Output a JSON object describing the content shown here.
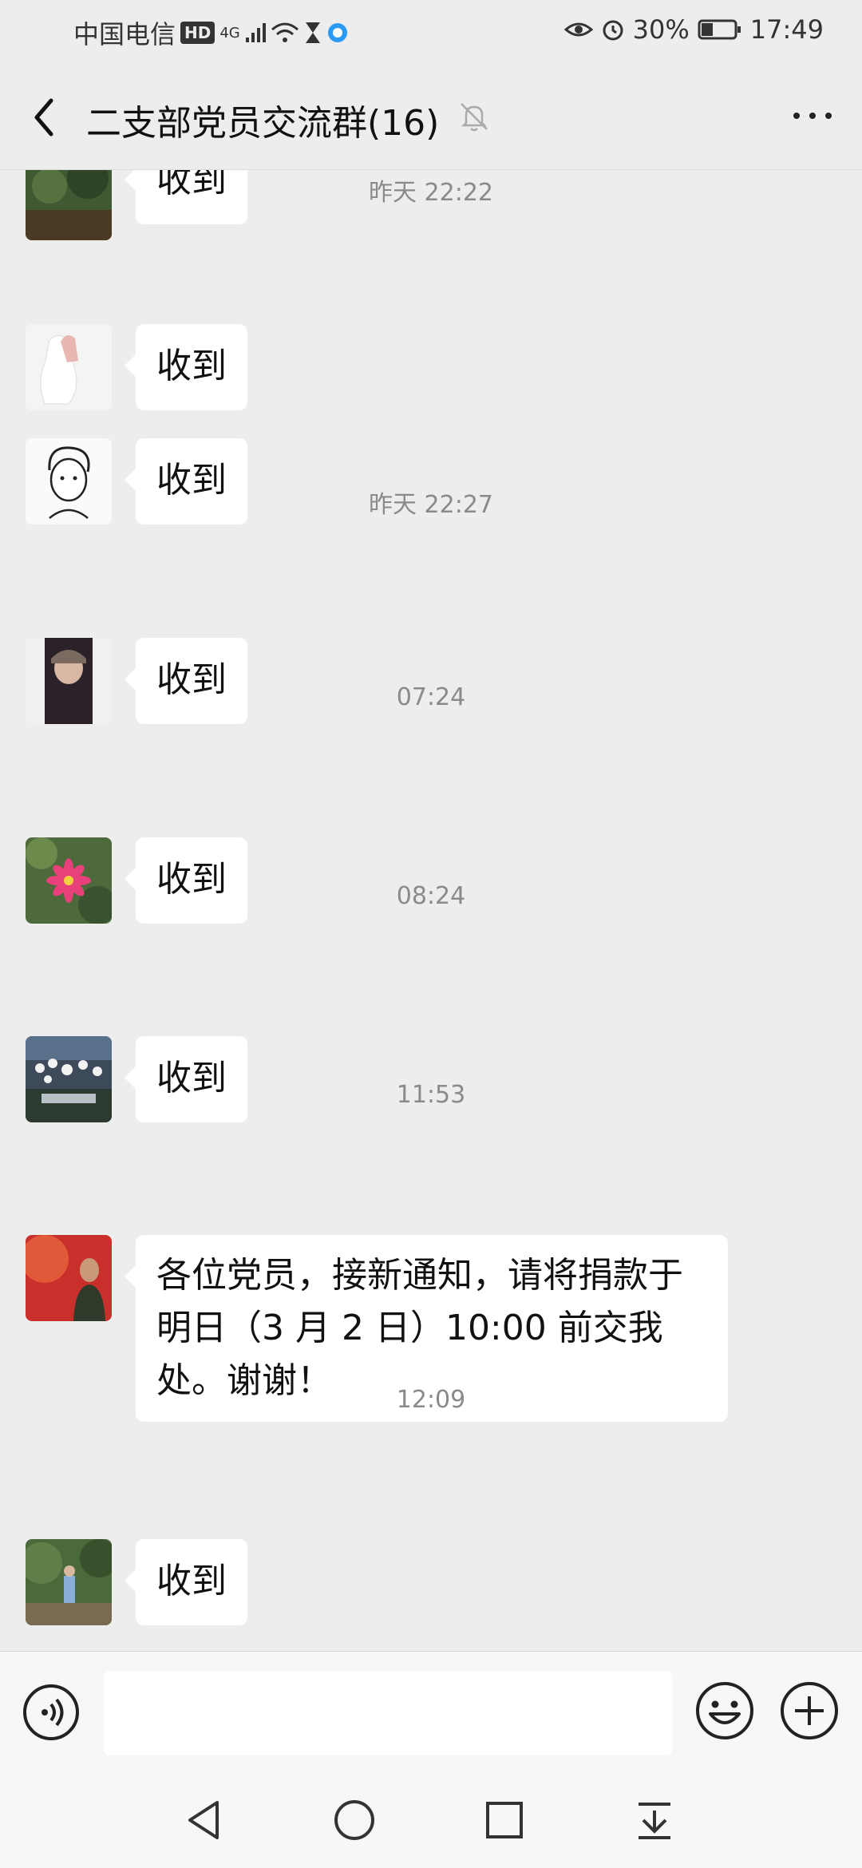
{
  "status_bar": {
    "carrier": "中国电信",
    "hd": "HD",
    "network": "4G",
    "battery": "30%",
    "time": "17:49"
  },
  "header": {
    "title": "二支部党员交流群(16)"
  },
  "messages": [
    {
      "text": "收到"
    },
    {
      "timestamp": "昨天 22:22"
    },
    {
      "text": "收到"
    },
    {
      "text": "收到"
    },
    {
      "timestamp": "昨天 22:27"
    },
    {
      "text": "收到"
    },
    {
      "timestamp": "07:24"
    },
    {
      "text": "收到"
    },
    {
      "timestamp": "08:24"
    },
    {
      "text": "收到"
    },
    {
      "timestamp": "11:53"
    },
    {
      "text": "各位党员，接新通知，请将捐款于明日（3 月 2 日）10:00 前交我处。谢谢！"
    },
    {
      "timestamp": "12:09"
    },
    {
      "text": "收到"
    }
  ],
  "input": {
    "value": "",
    "placeholder": ""
  },
  "colors": {
    "background": "#ededed",
    "bubble": "#ffffff",
    "timestamp": "#8a8a8a"
  },
  "icons": [
    "back-arrow-icon",
    "mute-bell-icon",
    "more-icon",
    "voice-icon",
    "emoji-icon",
    "plus-icon",
    "nav-back-icon",
    "nav-home-icon",
    "nav-recents-icon",
    "nav-dropdown-icon"
  ]
}
